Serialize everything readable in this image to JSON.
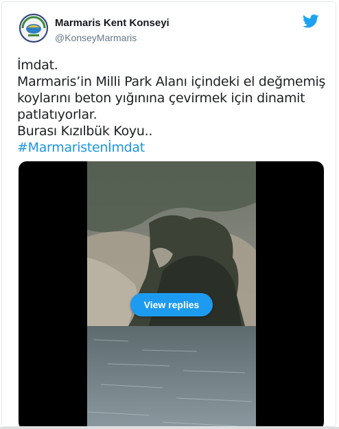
{
  "tweet": {
    "display_name": "Marmaris Kent Konseyi",
    "handle": "@KonseyMarmaris",
    "text_lines": [
      "İmdat.",
      "Marmaris’in Milli Park Alanı içindeki el değmemiş",
      "koylarını beton yığınına çevirmek için dinamit",
      "patlatıyorlar.",
      "Burası Kızılbük Koyu.."
    ],
    "hashtag": "#Marmaristenİmdat"
  },
  "media": {
    "view_replies_label": "View replies"
  },
  "icons": {
    "twitter_logo": "twitter-bird-icon",
    "avatar": "organization-logo"
  },
  "colors": {
    "accent": "#1d9bf0",
    "hashtag": "#1b95e0",
    "handle": "#657786"
  }
}
